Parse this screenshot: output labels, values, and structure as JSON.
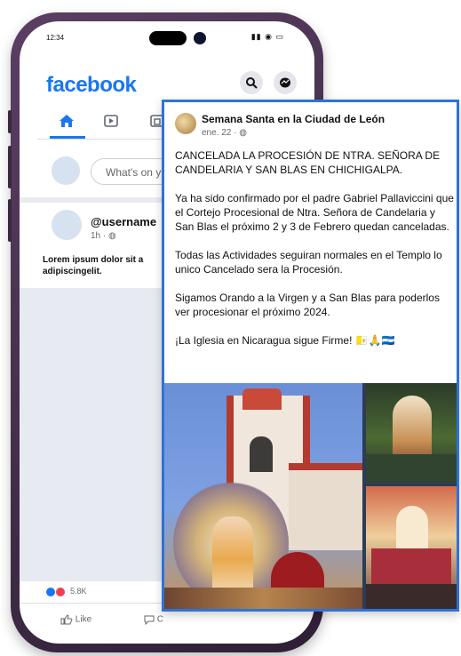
{
  "phone": {
    "status_time": "12:34",
    "status_icons": "▮▮ ◉ ▭"
  },
  "facebook": {
    "logo": "facebook",
    "composer_placeholder": "What's on yo",
    "post": {
      "username": "@username",
      "meta": "1h · ◍",
      "text": "Lorem ipsum dolor sit a adipiscingelit."
    },
    "reactions_count": "5.8K",
    "actions": {
      "like": "Like",
      "comment": "C"
    },
    "icons": [
      "home-icon",
      "video-icon",
      "marketplace-icon",
      "search-icon",
      "messenger-icon"
    ]
  },
  "card": {
    "author": "Semana Santa en la Ciudad de León",
    "meta": "ene. 22 · ◍",
    "paragraphs": [
      "CANCELADA LA PROCESIÓN DE NTRA. SEÑORA DE CANDELARIA Y SAN BLAS EN CHICHIGALPA.",
      "Ya ha sido confirmado por el padre Gabriel Pallaviccini que el Cortejo Procesional de Ntra. Señora de Candelaria y San Blas el próximo 2 y 3 de Febrero quedan canceladas.",
      "Todas las Actividades seguiran normales en el Templo lo unico Cancelado sera la Procesión.",
      "Sigamos Orando a la Virgen y a San Blas para poderlos ver procesionar el próximo 2024.",
      "¡La Iglesia en Nicaragua sigue Firme! 🇻🇦🙏🇳🇮"
    ]
  },
  "colors": {
    "facebook_blue": "#1877f2",
    "card_border": "#2f72d7",
    "phone_frame": "#4a3350"
  }
}
